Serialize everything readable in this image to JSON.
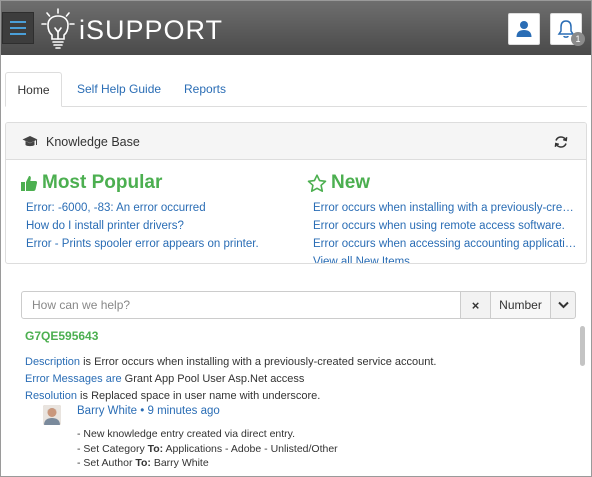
{
  "app": {
    "title": "iSUPPORT",
    "notification_count": "1"
  },
  "tabs": [
    {
      "label": "Home"
    },
    {
      "label": "Self Help Guide"
    },
    {
      "label": "Reports"
    }
  ],
  "knowledge_base": {
    "title": "Knowledge Base",
    "popular": {
      "heading": "Most Popular",
      "items": [
        "Error: -6000, -83: An error occurred",
        "How do I install printer drivers?",
        "Error - Prints spooler error appears on printer."
      ]
    },
    "new": {
      "heading": "New",
      "items": [
        "Error occurs when installing with a previously-created service account.",
        "Error occurs when using remote access software.",
        "Error occurs when accessing accounting application."
      ],
      "view_all": "View all New Items"
    }
  },
  "search": {
    "placeholder": "How can we help?",
    "clear_label": "×",
    "mode_label": "Number"
  },
  "result": {
    "id": "G7QE595643",
    "fields": [
      {
        "key": "Description",
        "conj": "is",
        "value": "Error occurs when installing with a previously-created service account."
      },
      {
        "key": "Error Messages",
        "conj": "are",
        "value": "Grant App Pool User Asp.Net access"
      },
      {
        "key": "Resolution",
        "conj": "is",
        "value": "Replaced space in user name with underscore."
      }
    ],
    "activity": {
      "author": "Barry White",
      "separator": "•",
      "time": "9 minutes ago",
      "lines": [
        {
          "prefix": "- New knowledge entry created via direct entry.",
          "strong": "",
          "rest": ""
        },
        {
          "prefix": "- Set Category ",
          "strong": "To:",
          "rest": " Applications - Adobe - Unlisted/Other"
        },
        {
          "prefix": "- Set Author ",
          "strong": "To:",
          "rest": " Barry White"
        }
      ]
    }
  },
  "colors": {
    "header_bg": "#5a5a5a",
    "accent_blue": "#2a6db5",
    "accent_green": "#4caf50"
  }
}
